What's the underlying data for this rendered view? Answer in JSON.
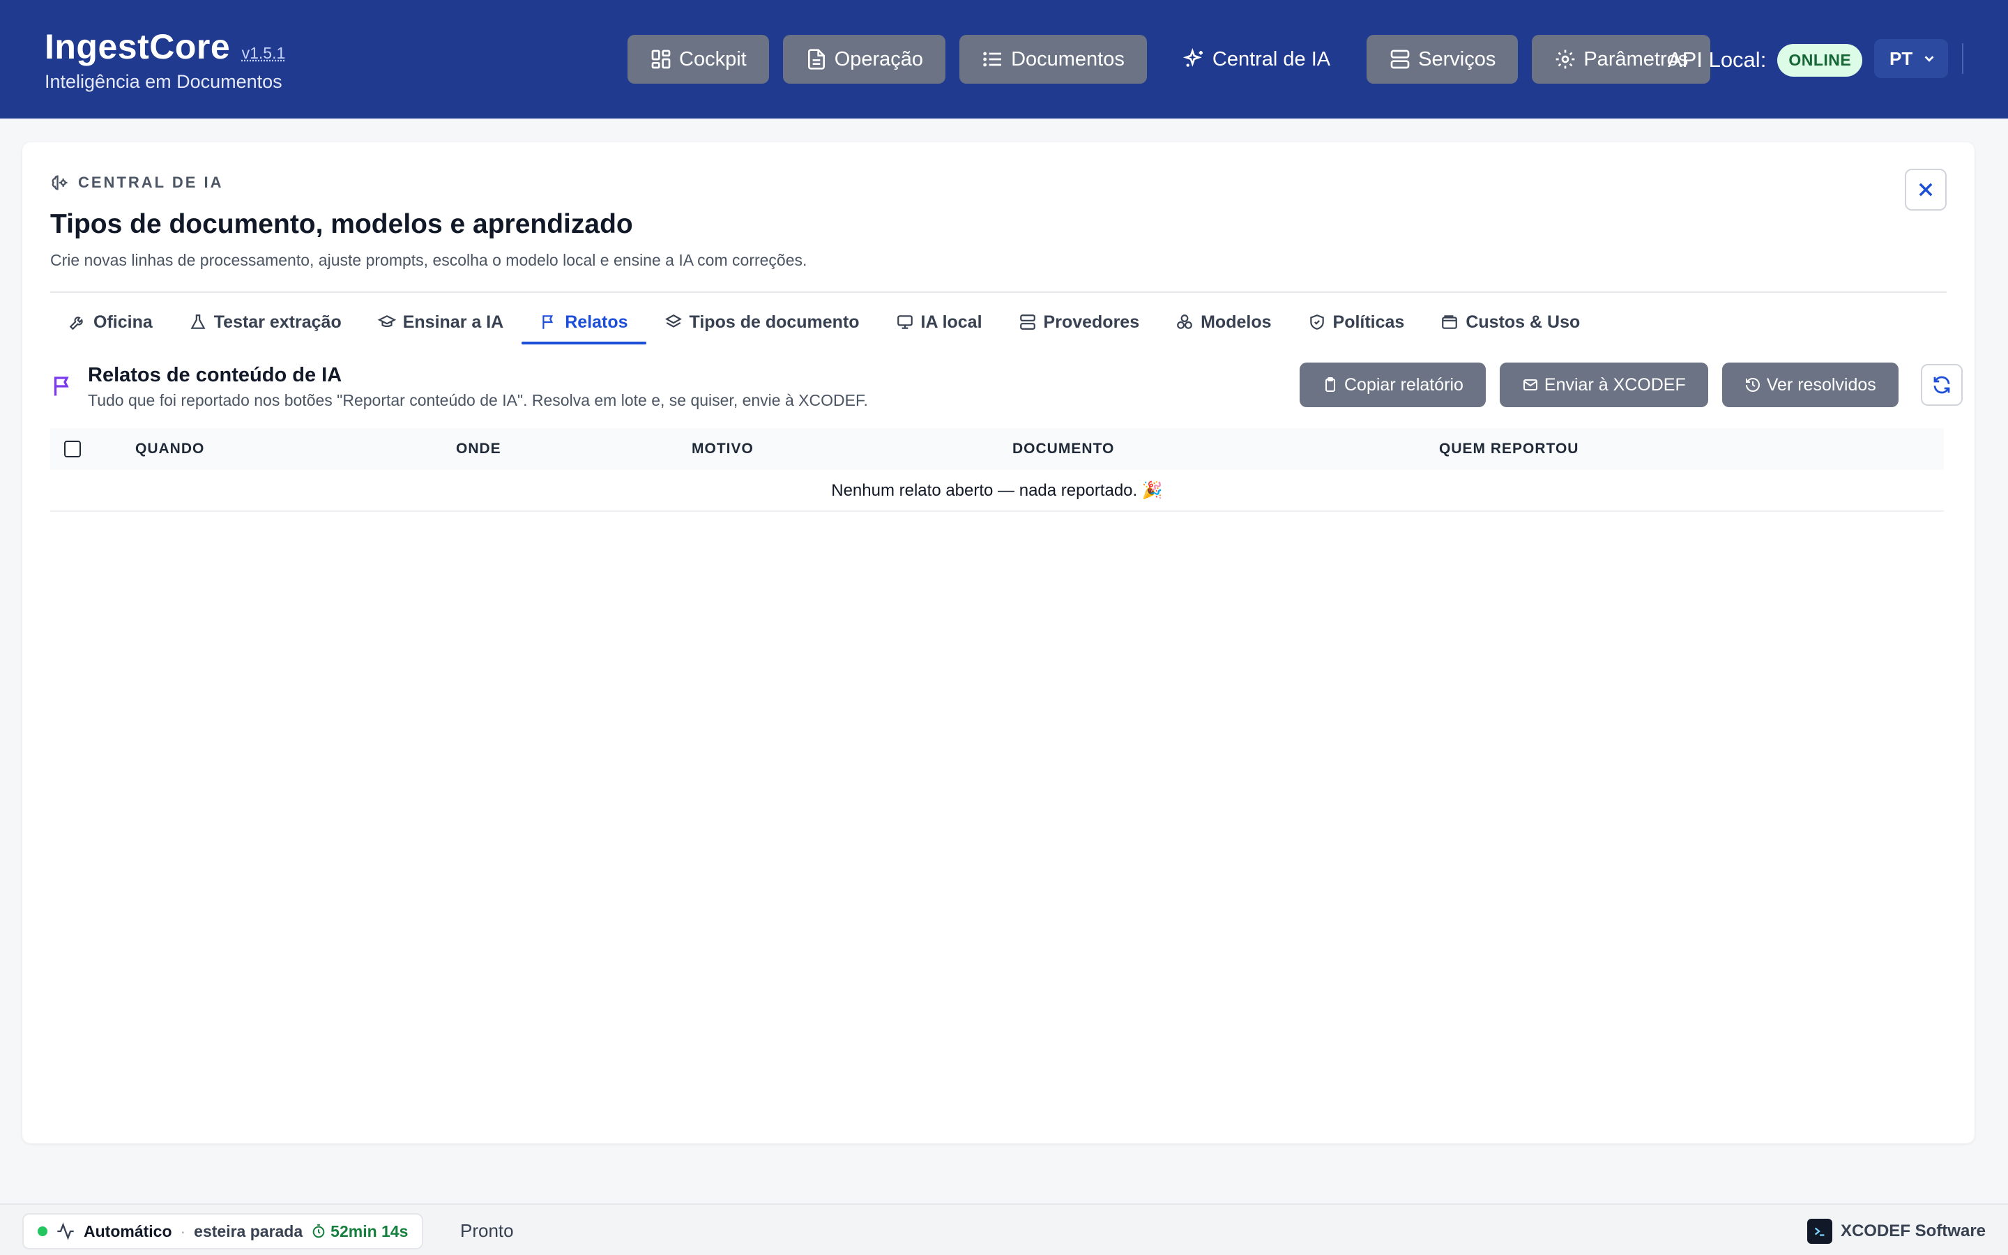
{
  "app": {
    "name": "IngestCore",
    "version": "v1.5.1",
    "subtitle": "Inteligência em Documentos"
  },
  "nav": {
    "items": [
      {
        "label": "Cockpit",
        "icon": "layout-dashboard-icon"
      },
      {
        "label": "Operação",
        "icon": "file-text-icon"
      },
      {
        "label": "Documentos",
        "icon": "list-icon"
      },
      {
        "label": "Central de IA",
        "icon": "sparkles-icon",
        "active": true
      },
      {
        "label": "Serviços",
        "icon": "server-icon"
      },
      {
        "label": "Parâmetros",
        "icon": "gear-icon"
      }
    ],
    "api_label": "API Local:",
    "api_status": "ONLINE",
    "language": "PT"
  },
  "panel": {
    "eyebrow": "CENTRAL DE IA",
    "title": "Tipos de documento, modelos e aprendizado",
    "description": "Crie novas linhas de processamento, ajuste prompts, escolha o modelo local e ensine a IA com correções."
  },
  "tabs": [
    {
      "label": "Oficina",
      "icon": "wrench-icon"
    },
    {
      "label": "Testar extração",
      "icon": "flask-icon"
    },
    {
      "label": "Ensinar a IA",
      "icon": "graduation-cap-icon"
    },
    {
      "label": "Relatos",
      "icon": "flag-icon",
      "active": true
    },
    {
      "label": "Tipos de documento",
      "icon": "layers-icon"
    },
    {
      "label": "IA local",
      "icon": "monitor-icon"
    },
    {
      "label": "Provedores",
      "icon": "server-icon"
    },
    {
      "label": "Modelos",
      "icon": "boxes-icon"
    },
    {
      "label": "Políticas",
      "icon": "shield-icon"
    },
    {
      "label": "Custos & Uso",
      "icon": "wallet-icon"
    }
  ],
  "reports": {
    "title": "Relatos de conteúdo de IA",
    "description": "Tudo que foi reportado nos botões \"Reportar conteúdo de IA\". Resolva em lote e, se quiser, envie à XCODEF.",
    "actions": {
      "copy": "Copiar relatório",
      "send": "Enviar à XCODEF",
      "resolved": "Ver resolvidos"
    },
    "columns": [
      "QUANDO",
      "ONDE",
      "MOTIVO",
      "DOCUMENTO",
      "QUEM REPORTOU"
    ],
    "empty_message": "Nenhum relato aberto — nada reportado. 🎉"
  },
  "footer": {
    "mode": "Automático",
    "separator": "·",
    "conveyor_status": "esteira parada",
    "timer": "52min 14s",
    "status": "Pronto",
    "vendor": "XCODEF Software"
  },
  "colors": {
    "header_bg": "#1f3a8f",
    "accent": "#1d4ed8",
    "button_bg": "#6b7385",
    "online_bg": "#dcfce7",
    "flag_accent": "#7c3aed",
    "status_green": "#22c55e"
  }
}
